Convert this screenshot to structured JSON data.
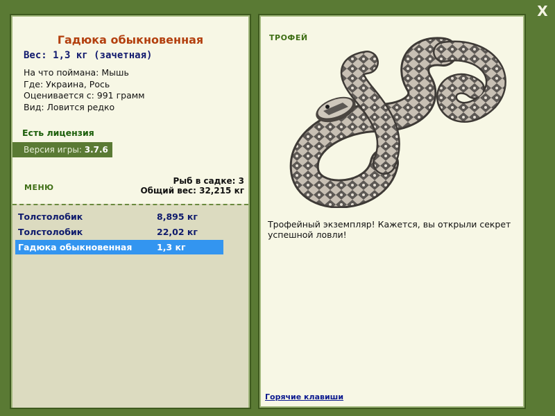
{
  "window": {
    "close_label": "X"
  },
  "fish": {
    "name": "Гадюка обыкновенная",
    "weight_line": "Вес: 1,3 кг (зачетная)",
    "info": [
      "На что поймана: Мышь",
      "Где: Украина, Рось",
      "Оценивается с: 991 грамм",
      "Вид: Ловится редко"
    ]
  },
  "license": "Есть лицензия",
  "version": {
    "label": "Версия игры:",
    "value": "3.7.6"
  },
  "menu_label": "МЕНЮ",
  "cage": {
    "count_line": "Рыб в садке: 3",
    "total_line": "Общий вес: 32,215 кг"
  },
  "catch_list": [
    {
      "name": "Толстолобик",
      "weight": "8,895 кг",
      "selected": false
    },
    {
      "name": "Толстолобик",
      "weight": "22,02 кг",
      "selected": false
    },
    {
      "name": "Гадюка обыкновенная",
      "weight": "1,3 кг",
      "selected": true
    }
  ],
  "trophy": {
    "label": "ТРОФЕЙ",
    "description": "Трофейный экземпляр! Кажется, вы открыли секрет успешной ловли!"
  },
  "hotkeys_link": "Горячие клавиши",
  "colors": {
    "background": "#5a7a34",
    "panel": "#f7f7e5",
    "title": "#b3400f",
    "selected_row": "#3395f0",
    "link": "#0c1a8f"
  }
}
